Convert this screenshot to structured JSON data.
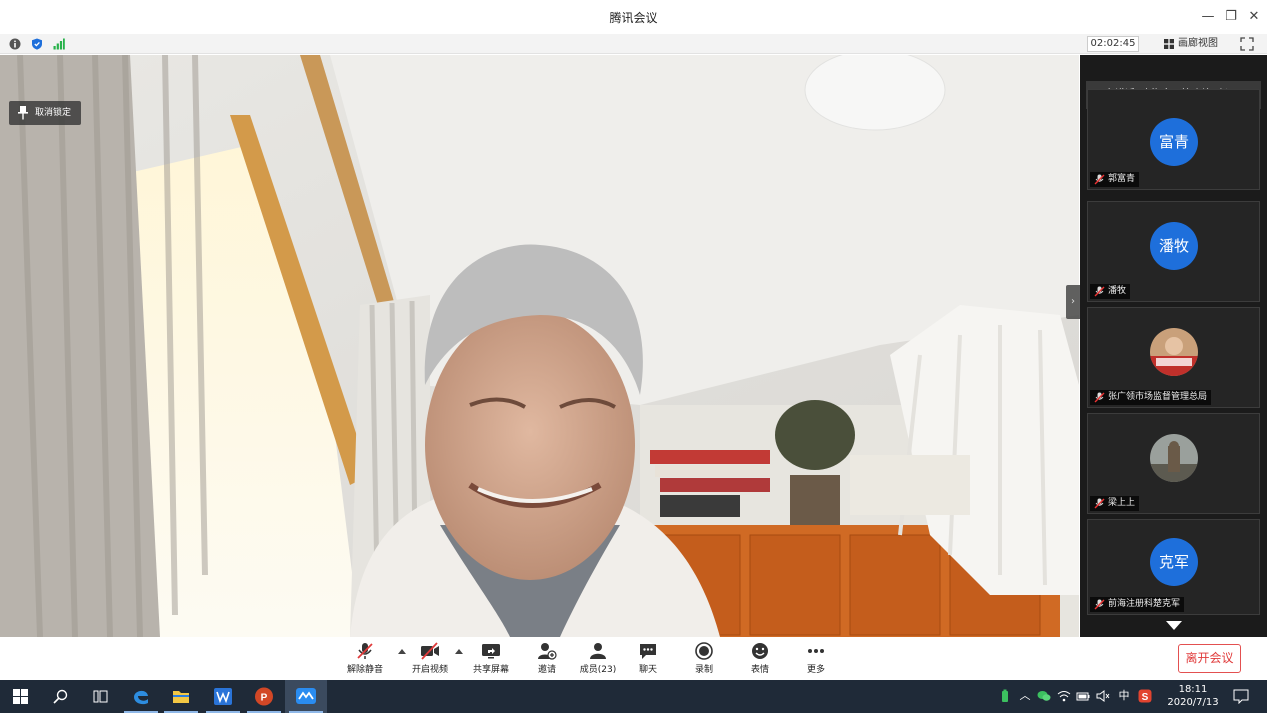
{
  "window": {
    "title": "腾讯会议",
    "minimize_symbol": "—",
    "restore_symbol": "❐",
    "close_symbol": "✕"
  },
  "status_bar": {
    "icons": [
      "info-icon",
      "shield-icon",
      "signal-icon"
    ],
    "timer": "02:02:45",
    "gallery_view_label": "画廊视图"
  },
  "main_video": {
    "unlock_label": "取消锁定"
  },
  "participants_panel": {
    "speaking_text": "正在讲话: 南海白云管晓峰; 赵...",
    "tiles": [
      {
        "avatar_text": "富青",
        "name": "郭富青",
        "avatar_type": "initials"
      },
      {
        "avatar_text": "潘牧",
        "name": "潘牧",
        "avatar_type": "initials"
      },
      {
        "avatar_text": "",
        "name": "张广领市场监督管理总局",
        "avatar_type": "photo"
      },
      {
        "avatar_text": "",
        "name": "梁上上",
        "avatar_type": "photo"
      },
      {
        "avatar_text": "克军",
        "name": "前海注册科楚克军",
        "avatar_type": "initials"
      }
    ]
  },
  "toolbar": {
    "unmute_label": "解除静音",
    "start_video_label": "开启视频",
    "share_screen_label": "共享屏幕",
    "invite_label": "邀请",
    "members_label": "成员(23)",
    "chat_label": "聊天",
    "record_label": "录制",
    "emoji_label": "表情",
    "more_label": "更多",
    "leave_label": "离开会议"
  },
  "taskbar": {
    "apps": [
      "windows-start-icon",
      "search-icon",
      "task-view-icon",
      "edge-icon",
      "file-explorer-icon",
      "wps-icon",
      "powerpoint-icon",
      "tencent-meeting-icon"
    ],
    "ime_label": "中",
    "time": "18:11",
    "date": "2020/7/13"
  },
  "colors": {
    "accent_blue": "#1e6fdb",
    "leave_red": "#e03a3a",
    "panel_bg": "#1b1b1b",
    "taskbar_bg": "#1f2a38"
  }
}
